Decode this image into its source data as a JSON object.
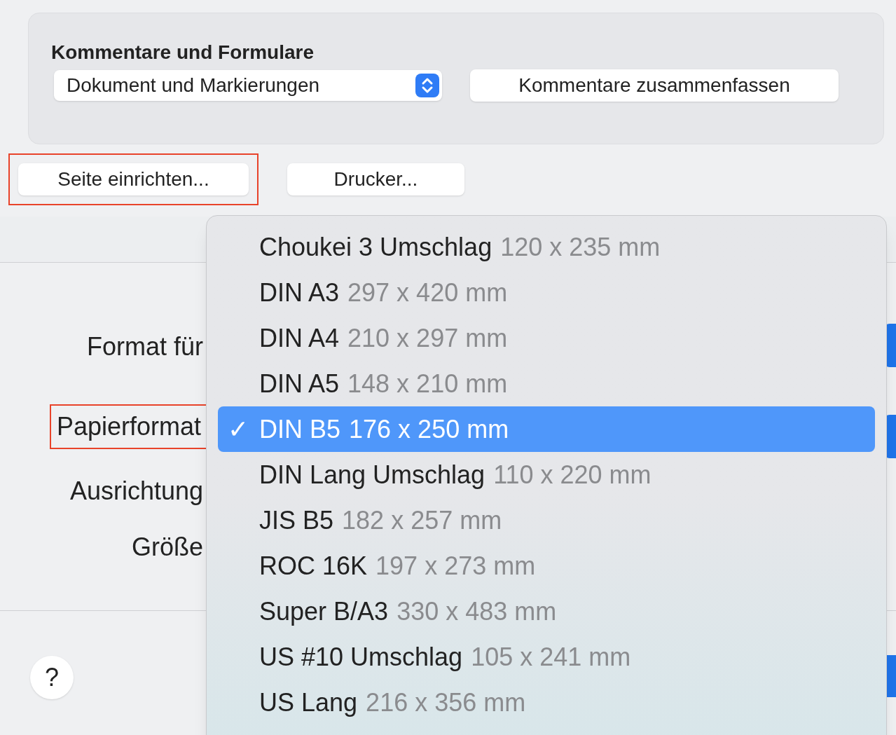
{
  "comments_panel": {
    "title": "Kommentare und Formulare",
    "popup": {
      "value": "Dokument und Markierungen"
    },
    "button": "Kommentare zusammenfassen"
  },
  "buttons": [
    {
      "label": "Seite einrichten...",
      "highlighted": true
    },
    {
      "label": "Drucker...",
      "highlighted": false
    }
  ],
  "form_labels": [
    {
      "label": "Format für",
      "highlighted": false
    },
    {
      "label": "Papierformat",
      "highlighted": true
    },
    {
      "label": "Ausrichtung",
      "highlighted": false
    },
    {
      "label": "Größe",
      "highlighted": false
    }
  ],
  "help_button": "?",
  "paper_menu": [
    {
      "name": "Choukei 3 Umschlag",
      "size": "120 x 235 mm",
      "selected": false
    },
    {
      "name": "DIN A3",
      "size": "297 x 420 mm",
      "selected": false
    },
    {
      "name": "DIN A4",
      "size": "210 x 297 mm",
      "selected": false
    },
    {
      "name": "DIN A5",
      "size": "148 x 210 mm",
      "selected": false
    },
    {
      "name": "DIN B5",
      "size": "176 x 250 mm",
      "selected": true
    },
    {
      "name": "DIN Lang Umschlag",
      "size": "110 x 220 mm",
      "selected": false
    },
    {
      "name": "JIS B5",
      "size": "182 x 257 mm",
      "selected": false
    },
    {
      "name": "ROC 16K",
      "size": "197 x 273 mm",
      "selected": false
    },
    {
      "name": "Super B/A3",
      "size": "330 x 483 mm",
      "selected": false
    },
    {
      "name": "US #10 Umschlag",
      "size": "105 x 241 mm",
      "selected": false
    },
    {
      "name": "US Lang",
      "size": "216 x 356 mm",
      "selected": false
    }
  ],
  "check_mark": "✓"
}
